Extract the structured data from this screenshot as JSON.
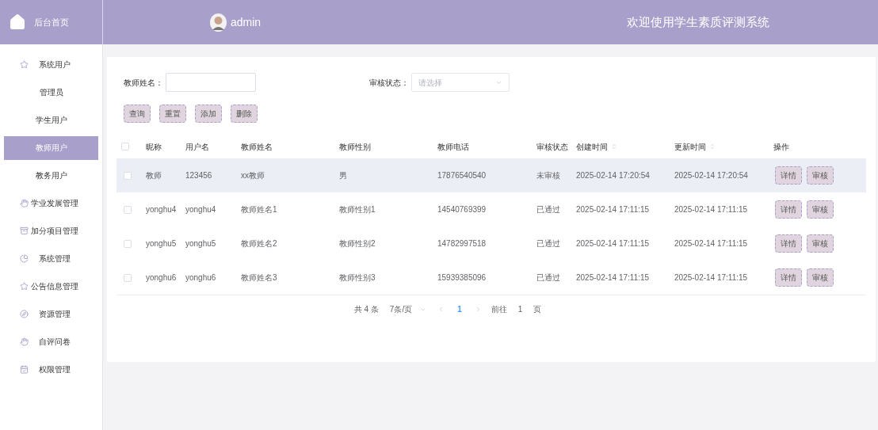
{
  "header": {
    "home_label": "后台首页",
    "username": "admin",
    "title": "欢迎使用学生素质评测系统"
  },
  "sidebar": {
    "items": [
      {
        "label": "系统用户",
        "children": [
          {
            "label": "管理员",
            "selected": false
          },
          {
            "label": "学生用户",
            "selected": false
          },
          {
            "label": "教师用户",
            "selected": true
          },
          {
            "label": "教务用户",
            "selected": false
          }
        ]
      },
      {
        "label": "学业发展管理"
      },
      {
        "label": "加分项目管理"
      },
      {
        "label": "系统管理"
      },
      {
        "label": "公告信息管理"
      },
      {
        "label": "资源管理"
      },
      {
        "label": "自评问卷"
      },
      {
        "label": "权限管理"
      }
    ]
  },
  "filters": [
    {
      "label": "教师姓名：",
      "kind": "input"
    },
    {
      "label": "审核状态：",
      "kind": "select",
      "placeholder": "请选择"
    }
  ],
  "toolbar": [
    "查询",
    "重置",
    "添加",
    "删除"
  ],
  "table": {
    "all_checked": false,
    "columns": [
      {
        "label": "昵称",
        "sortable": false
      },
      {
        "label": "用户名",
        "sortable": false
      },
      {
        "label": "教师姓名",
        "sortable": false
      },
      {
        "label": "教师性别",
        "sortable": false
      },
      {
        "label": "教师电话",
        "sortable": false
      },
      {
        "label": "审核状态",
        "sortable": false
      },
      {
        "label": "创建时间",
        "sortable": true
      },
      {
        "label": "更新时间",
        "sortable": true
      },
      {
        "label": "操作",
        "sortable": false
      }
    ],
    "rows": [
      {
        "checked": false,
        "highlighted": true,
        "cells": [
          "教师",
          "123456",
          "xx教师",
          "男",
          "17876540540",
          "未审核",
          "2025-02-14 17:20:54",
          "2025-02-14 17:20:54"
        ],
        "actions": [
          "详情",
          "审核"
        ]
      },
      {
        "checked": false,
        "highlighted": false,
        "cells": [
          "yonghu4",
          "yonghu4",
          "教师姓名1",
          "教师性别1",
          "14540769399",
          "已通过",
          "2025-02-14 17:11:15",
          "2025-02-14 17:11:15"
        ],
        "actions": [
          "详情",
          "审核"
        ]
      },
      {
        "checked": false,
        "highlighted": false,
        "cells": [
          "yonghu5",
          "yonghu5",
          "教师姓名2",
          "教师性别2",
          "14782997518",
          "已通过",
          "2025-02-14 17:11:15",
          "2025-02-14 17:11:15"
        ],
        "actions": [
          "详情",
          "审核"
        ]
      },
      {
        "checked": false,
        "highlighted": false,
        "cells": [
          "yonghu6",
          "yonghu6",
          "教师姓名3",
          "教师性别3",
          "15939385096",
          "已通过",
          "2025-02-14 17:11:15",
          "2025-02-14 17:11:15"
        ],
        "actions": [
          "详情",
          "审核"
        ]
      }
    ]
  },
  "pagination": {
    "total": "共 4 条",
    "page_size": "7条/页",
    "pages": [
      {
        "label": "1",
        "selected": true
      }
    ],
    "goto_label": "前往",
    "goto_value": "1",
    "goto_suffix": "页"
  }
}
